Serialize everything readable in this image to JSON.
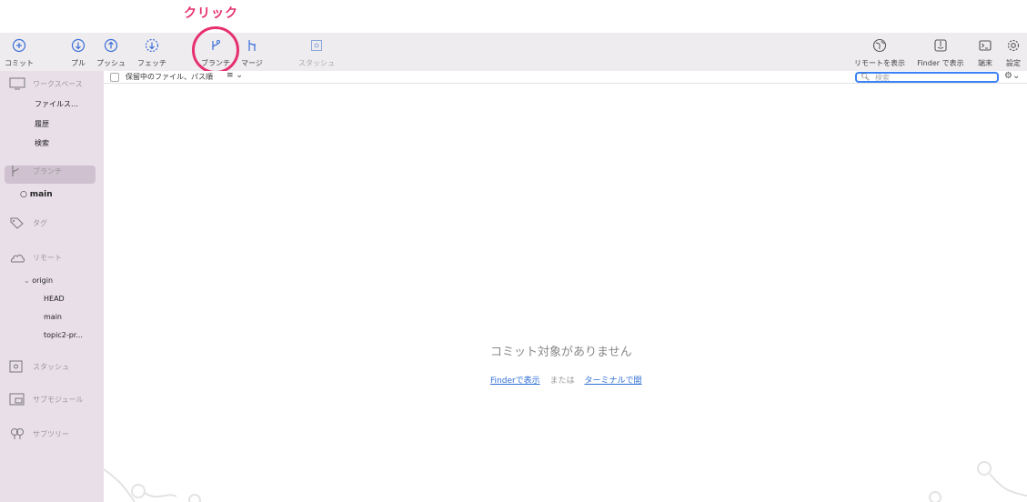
{
  "annotation": {
    "text": "クリック"
  },
  "toolbar": {
    "commit": "コミット",
    "pull": "プル",
    "push": "プッシュ",
    "fetch": "フェッチ",
    "branch": "ブランチ",
    "merge": "マージ",
    "stash": "スタッシュ",
    "show_remote": "リモートを表示",
    "show_finder": "Finder で表示",
    "terminal": "端末",
    "settings": "設定"
  },
  "filter": {
    "label": "保留中のファイル、パス順",
    "options_icon": "≡ ⌄"
  },
  "search": {
    "placeholder": "検索",
    "icon": "magnifier-icon"
  },
  "sidebar": {
    "workspace": {
      "header": "ワークスペース",
      "items": [
        "ファイルス…",
        "履歴",
        "検索"
      ]
    },
    "branches": {
      "header": "ブランチ",
      "items": [
        "main"
      ]
    },
    "tags": {
      "header": "タグ"
    },
    "remotes": {
      "header": "リモート",
      "origin": "origin",
      "items": [
        "HEAD",
        "main",
        "topic2-pr..."
      ]
    },
    "stash": {
      "header": "スタッシュ"
    },
    "submodules": {
      "header": "サブモジュール"
    },
    "subtrees": {
      "header": "サブツリー"
    }
  },
  "main": {
    "empty_message": "コミット対象がありません",
    "finder_link": "Finderで表示",
    "or": "または",
    "terminal_link": "ターミナルで開"
  },
  "colors": {
    "annotation": "#e6306f",
    "sidebar_bg": "#e9dfe9",
    "toolbar_bg": "#efecef",
    "link": "#2f6ed6",
    "search_focus": "#3b82f6"
  }
}
